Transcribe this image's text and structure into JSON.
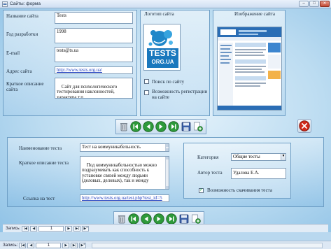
{
  "window": {
    "title": "Сайты: форма"
  },
  "site": {
    "name_label": "Название сайта",
    "name_value": "Tests",
    "year_label": "Год разработки",
    "year_value": "1998",
    "email_label": "E-mail",
    "email_value": "tests@ts.ua",
    "url_label": "Адрес сайта",
    "url_value": "http://www.tests.org.ua/",
    "desc_label": "Краткое описание сайта",
    "desc_value": "Сайт для психологического тестирования наклонностей, характера т.п.",
    "logo_label": "Логотип сайта",
    "logo_text_1": "TESTS",
    "logo_text_2": "ORG.UA",
    "image_label": "Изображение сайта",
    "search_label": "Поиск по сайту",
    "search_checked": false,
    "registration_label": "Возможность регистрации на сайте",
    "registration_checked": false
  },
  "test": {
    "name_label": "Наименование теста",
    "name_value": "Тест на коммуникабельность",
    "desc_label": "Краткое описание теста",
    "desc_value": "Под коммуникабельностью можно подразумевать как способность к установке связей между людьми (деловых, деловых), так и между",
    "link_label": "Ссылка на тест",
    "link_value": "http://www.tests.org.ua/test.php?test_id=5",
    "category_label": "Категория",
    "category_value": "Общие тесты",
    "author_label": "Автор теста",
    "author_value": "Удалова Е.А.",
    "download_label": "Возможность скачивания теста",
    "download_checked": true
  },
  "toolbar_icons": [
    "trash-icon",
    "first-record-icon",
    "prev-record-icon",
    "next-record-icon",
    "last-record-icon",
    "save-icon",
    "new-record-icon"
  ],
  "nav": {
    "record_label": "Запись:",
    "record_num": "1"
  },
  "colors": {
    "nav_green": "#2e9a3a",
    "delete_red": "#d02a1a",
    "accent_blue": "#1f3fbf"
  }
}
